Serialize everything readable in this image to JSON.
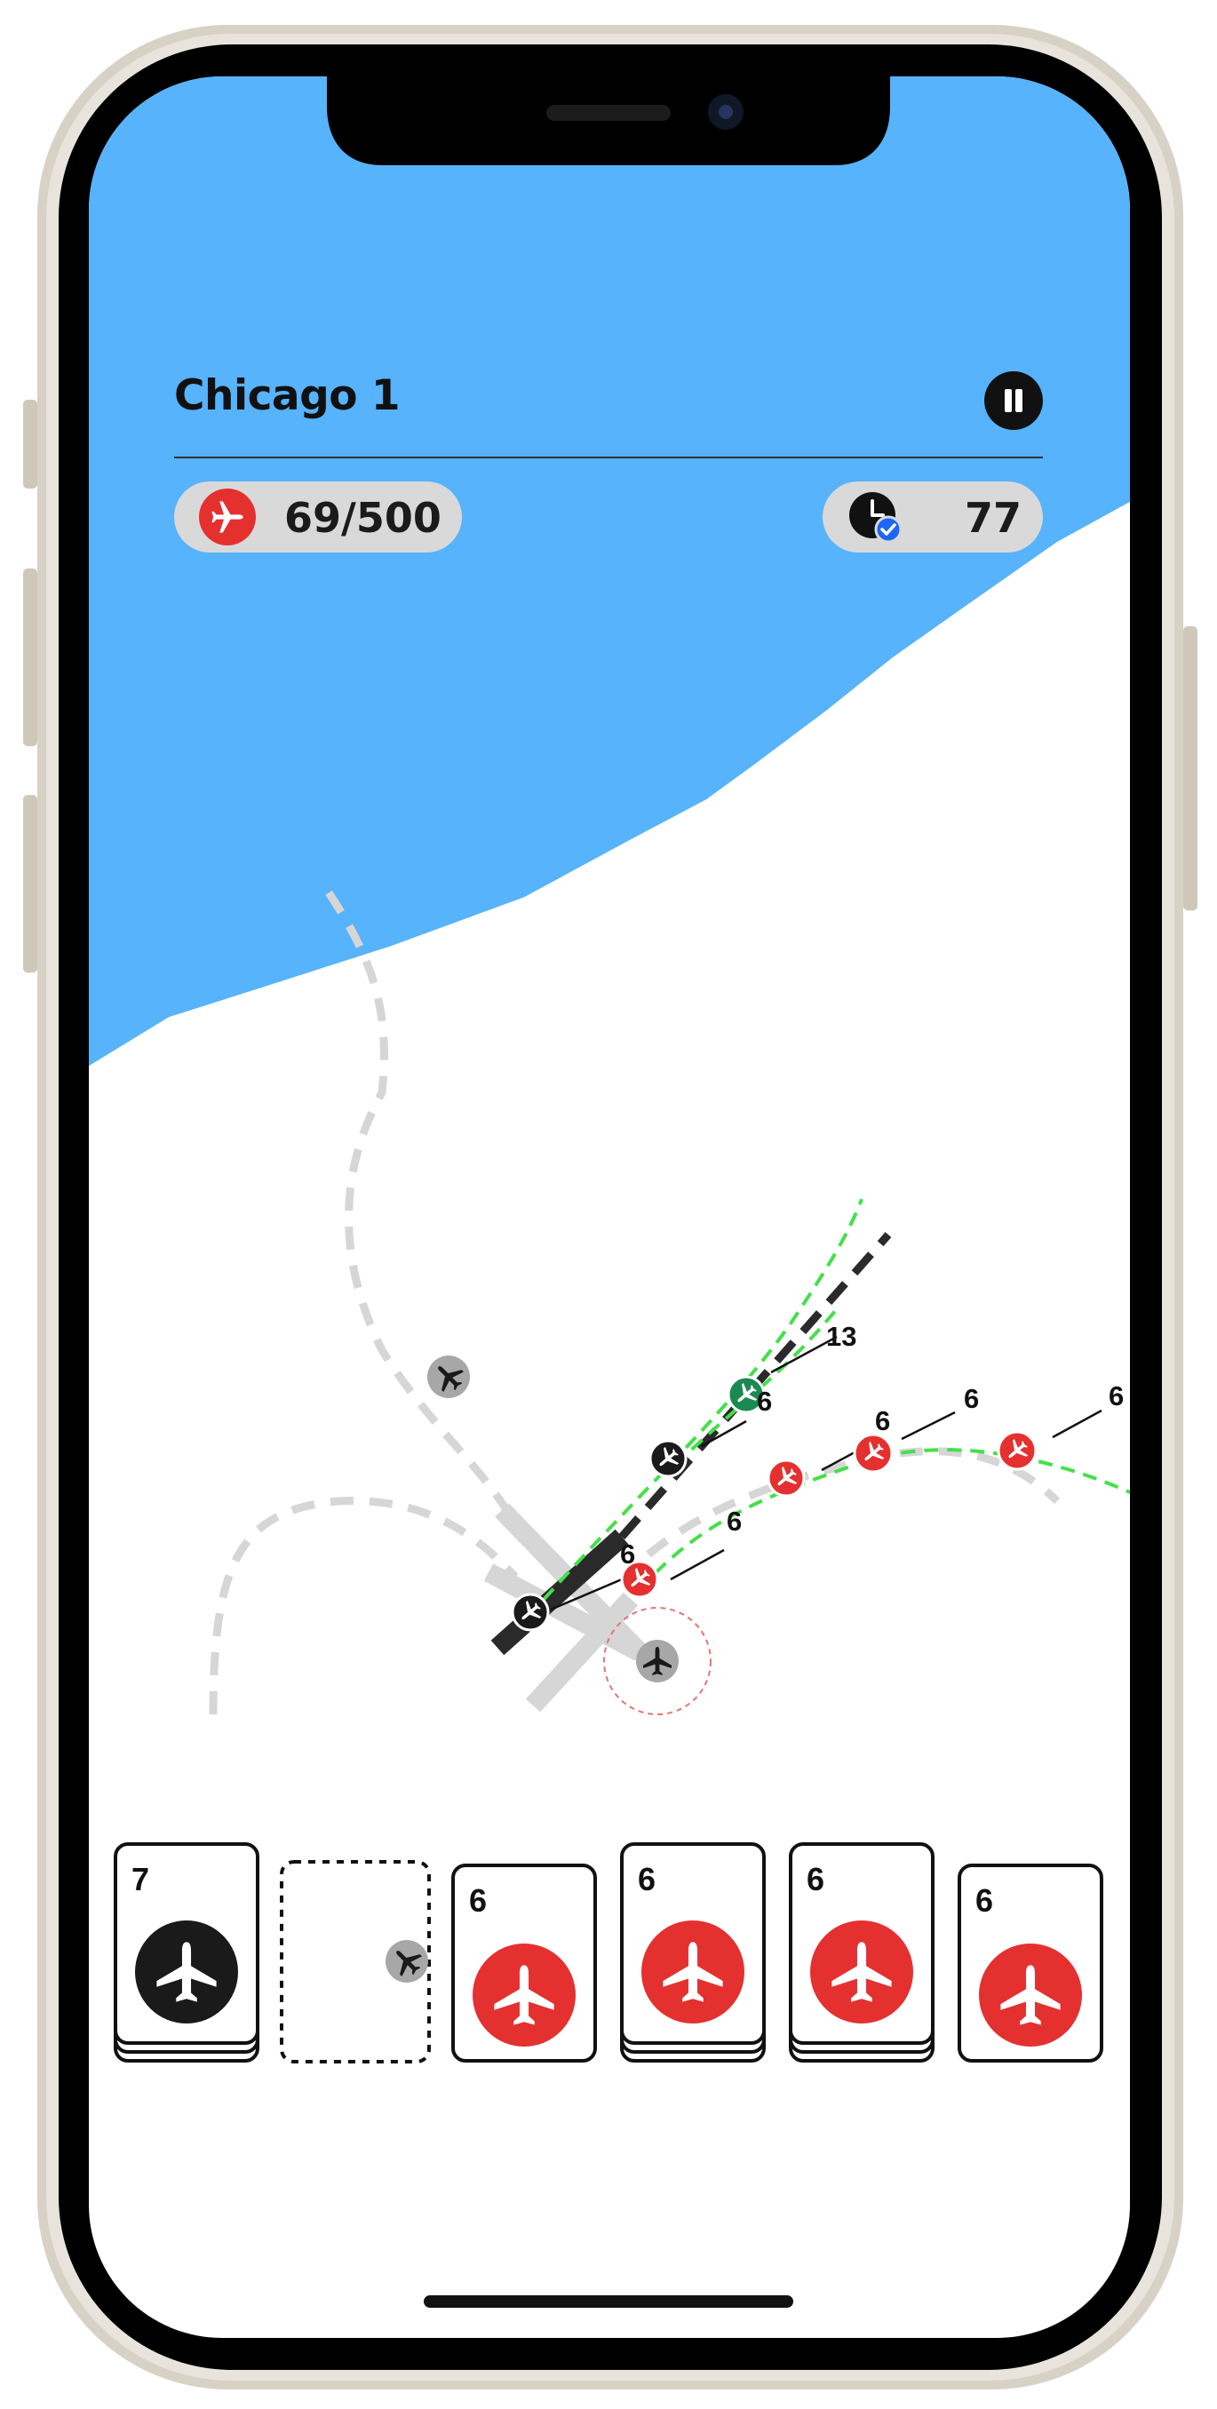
{
  "header": {
    "level_title": "Chicago 1",
    "pause_icon": "pause-icon"
  },
  "stats": {
    "planes_landed": "69/500",
    "planes_icon": "airplane-icon",
    "time": "77",
    "time_icon": "clock-check-icon"
  },
  "map": {
    "water_color": "#57b3fb",
    "land_color": "#ffffff",
    "runway_color": "#d6d6d6",
    "active_runway_color": "#2a2a2a",
    "path_color": "#44e04a",
    "aircraft_labels": [
      "13",
      "6",
      "6",
      "6",
      "6",
      "6",
      "6"
    ]
  },
  "queue": {
    "cards": [
      {
        "count": "7",
        "color": "#1a1a1a",
        "icon": "airplane-icon"
      },
      {
        "count": "",
        "color": "",
        "icon": "airplane-icon"
      },
      {
        "count": "6",
        "color": "#e53030",
        "icon": "airplane-icon"
      },
      {
        "count": "6",
        "color": "#e53030",
        "icon": "airplane-icon"
      },
      {
        "count": "6",
        "color": "#e53030",
        "icon": "airplane-icon"
      },
      {
        "count": "6",
        "color": "#e53030",
        "icon": "airplane-icon"
      }
    ]
  },
  "colors": {
    "red": "#e53030",
    "green": "#1a8a52",
    "dark": "#1a1a1a",
    "grey": "#a7a7a7"
  }
}
